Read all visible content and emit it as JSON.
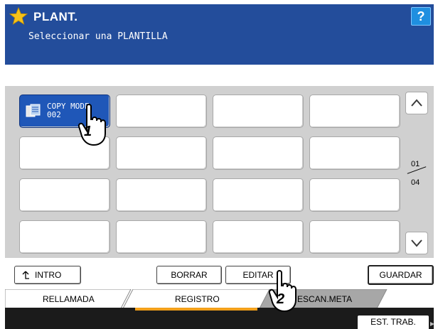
{
  "header": {
    "title": "PLANT.",
    "subtitle": "Seleccionar una PLANTILLA",
    "help_label": "?",
    "accent_color": "#234d9b"
  },
  "templates": [
    {
      "line1": "COPY MODE",
      "line2": "002",
      "active": true,
      "icon": "copy-icon"
    },
    {
      "line1": "",
      "line2": ""
    },
    {
      "line1": "",
      "line2": ""
    },
    {
      "line1": "",
      "line2": ""
    },
    {
      "line1": "",
      "line2": ""
    },
    {
      "line1": "",
      "line2": ""
    },
    {
      "line1": "",
      "line2": ""
    },
    {
      "line1": "",
      "line2": ""
    },
    {
      "line1": "",
      "line2": ""
    },
    {
      "line1": "",
      "line2": ""
    },
    {
      "line1": "",
      "line2": ""
    },
    {
      "line1": "",
      "line2": ""
    },
    {
      "line1": "",
      "line2": ""
    },
    {
      "line1": "",
      "line2": ""
    },
    {
      "line1": "",
      "line2": ""
    },
    {
      "line1": "",
      "line2": ""
    }
  ],
  "pagination": {
    "current": "01",
    "total": "04"
  },
  "buttons": {
    "intro": "INTRO",
    "borrar": "BORRAR",
    "editar": "EDITAR",
    "guardar": "GUARDAR"
  },
  "tabs": [
    {
      "label": "RELLAMADA",
      "active": false
    },
    {
      "label": "REGISTRO",
      "active": true
    },
    {
      "label": "ESCAN.META",
      "active": false
    }
  ],
  "status": {
    "job_status_label": "EST. TRAB."
  },
  "callouts": {
    "step1": "1",
    "step2": "2"
  }
}
